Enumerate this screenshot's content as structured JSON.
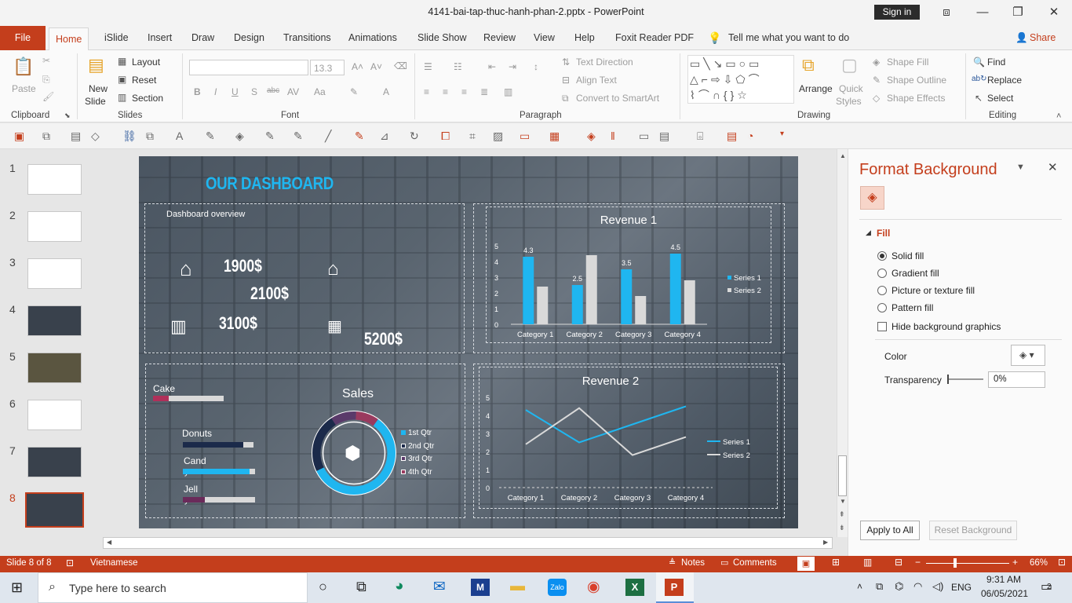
{
  "window": {
    "title": "4141-bai-tap-thuc-hanh-phan-2.pptx  -  PowerPoint",
    "sign_in": "Sign in"
  },
  "tabs": [
    "File",
    "Home",
    "iSlide",
    "Insert",
    "Draw",
    "Design",
    "Transitions",
    "Animations",
    "Slide Show",
    "Review",
    "View",
    "Help",
    "Foxit Reader PDF"
  ],
  "tell_me": "Tell me what you want to do",
  "share": "Share",
  "ribbon": {
    "clipboard": {
      "label": "Clipboard",
      "paste": "Paste"
    },
    "slides": {
      "label": "Slides",
      "new_slide_1": "New",
      "new_slide_2": "Slide",
      "layout": "Layout",
      "reset": "Reset",
      "section": "Section"
    },
    "font": {
      "label": "Font",
      "size": "13.3",
      "bold": "B",
      "italic": "I",
      "underline": "U",
      "shadow": "S",
      "strike": "abc"
    },
    "paragraph": {
      "label": "Paragraph",
      "text_direction": "Text Direction",
      "align_text": "Align Text",
      "smartart": "Convert to SmartArt"
    },
    "drawing": {
      "label": "Drawing",
      "arrange": "Arrange",
      "quick_styles_1": "Quick",
      "quick_styles_2": "Styles",
      "shape_fill": "Shape Fill",
      "shape_outline": "Shape Outline",
      "shape_effects": "Shape Effects"
    },
    "editing": {
      "label": "Editing",
      "find": "Find",
      "replace": "Replace",
      "select": "Select"
    }
  },
  "slides_panel": {
    "numbers": [
      "1",
      "2",
      "3",
      "4",
      "5",
      "6",
      "7",
      "8"
    ],
    "selected": 8
  },
  "slide": {
    "title": "OUR DASHBOARD",
    "overview": {
      "label": "Dashboard overview",
      "v1": "1900$",
      "v2": "2100$",
      "v3": "3100$",
      "v4": "5200$"
    },
    "bars": {
      "cake": "Cake",
      "donuts": "Donuts",
      "cand": "Cand",
      "cand_y": "y",
      "jell": "Jell",
      "jell_y": "y"
    },
    "sales": {
      "title": "Sales",
      "legend": [
        "1st Qtr",
        "2nd Qtr",
        "3rd Qtr",
        "4th Qtr"
      ]
    }
  },
  "chart_data": [
    {
      "type": "bar",
      "title": "Revenue 1",
      "categories": [
        "Category 1",
        "Category 2",
        "Category 3",
        "Category 4"
      ],
      "series": [
        {
          "name": "Series 1",
          "values": [
            4.3,
            2.5,
            3.5,
            4.5
          ],
          "color": "#1fb6f0"
        },
        {
          "name": "Series 2",
          "values": [
            2.4,
            4.4,
            1.8,
            2.8
          ],
          "color": "#d9d9d9"
        }
      ],
      "data_labels": [
        "4.3",
        "2.5",
        "3.5",
        "4.5"
      ],
      "ylim": [
        0,
        5
      ],
      "yticks": [
        "0",
        "1",
        "2",
        "3",
        "4",
        "5"
      ],
      "legend": "right"
    },
    {
      "type": "line",
      "title": "Revenue 2",
      "categories": [
        "Category 1",
        "Category 2",
        "Category 3",
        "Category 4"
      ],
      "series": [
        {
          "name": "Series 1",
          "values": [
            4.3,
            2.5,
            3.5,
            4.5
          ],
          "color": "#1fb6f0"
        },
        {
          "name": "Series 2",
          "values": [
            2.4,
            4.4,
            1.8,
            2.8
          ],
          "color": "#d9d9d9"
        }
      ],
      "ylim": [
        0,
        5
      ],
      "yticks": [
        "0",
        "1",
        "2",
        "3",
        "4",
        "5"
      ],
      "legend": "right"
    },
    {
      "type": "pie",
      "title": "Sales",
      "categories": [
        "1st Qtr",
        "2nd Qtr",
        "3rd Qtr",
        "4th Qtr"
      ],
      "values": [
        58,
        23,
        10,
        9
      ],
      "colors": [
        "#1fb6f0",
        "#1b2a4a",
        "#5a3a6a",
        "#9a3a5e"
      ]
    },
    {
      "type": "bar",
      "orientation": "horizontal",
      "categories": [
        "Cake",
        "Donuts",
        "Cand",
        "Jell"
      ],
      "values": [
        22,
        85,
        92,
        30
      ],
      "max": 100,
      "colors": [
        "#b0305a",
        "#1b2a4a",
        "#1fb6f0",
        "#6a2a5a"
      ]
    }
  ],
  "format_pane": {
    "title": "Format Background",
    "section": "Fill",
    "options": [
      "Solid fill",
      "Gradient fill",
      "Picture or texture fill",
      "Pattern fill"
    ],
    "selected": 0,
    "hide_bg": "Hide background graphics",
    "color": "Color",
    "transparency": "Transparency",
    "transparency_value": "0%",
    "apply_all": "Apply to All",
    "reset_bg": "Reset Background"
  },
  "status": {
    "slide": "Slide 8 of 8",
    "language": "Vietnamese",
    "notes": "Notes",
    "comments": "Comments",
    "zoom": "66%"
  },
  "taskbar": {
    "search": "Type here to search",
    "time": "9:31 AM",
    "date": "06/05/2021",
    "lang": "ENG",
    "badge": "2"
  }
}
